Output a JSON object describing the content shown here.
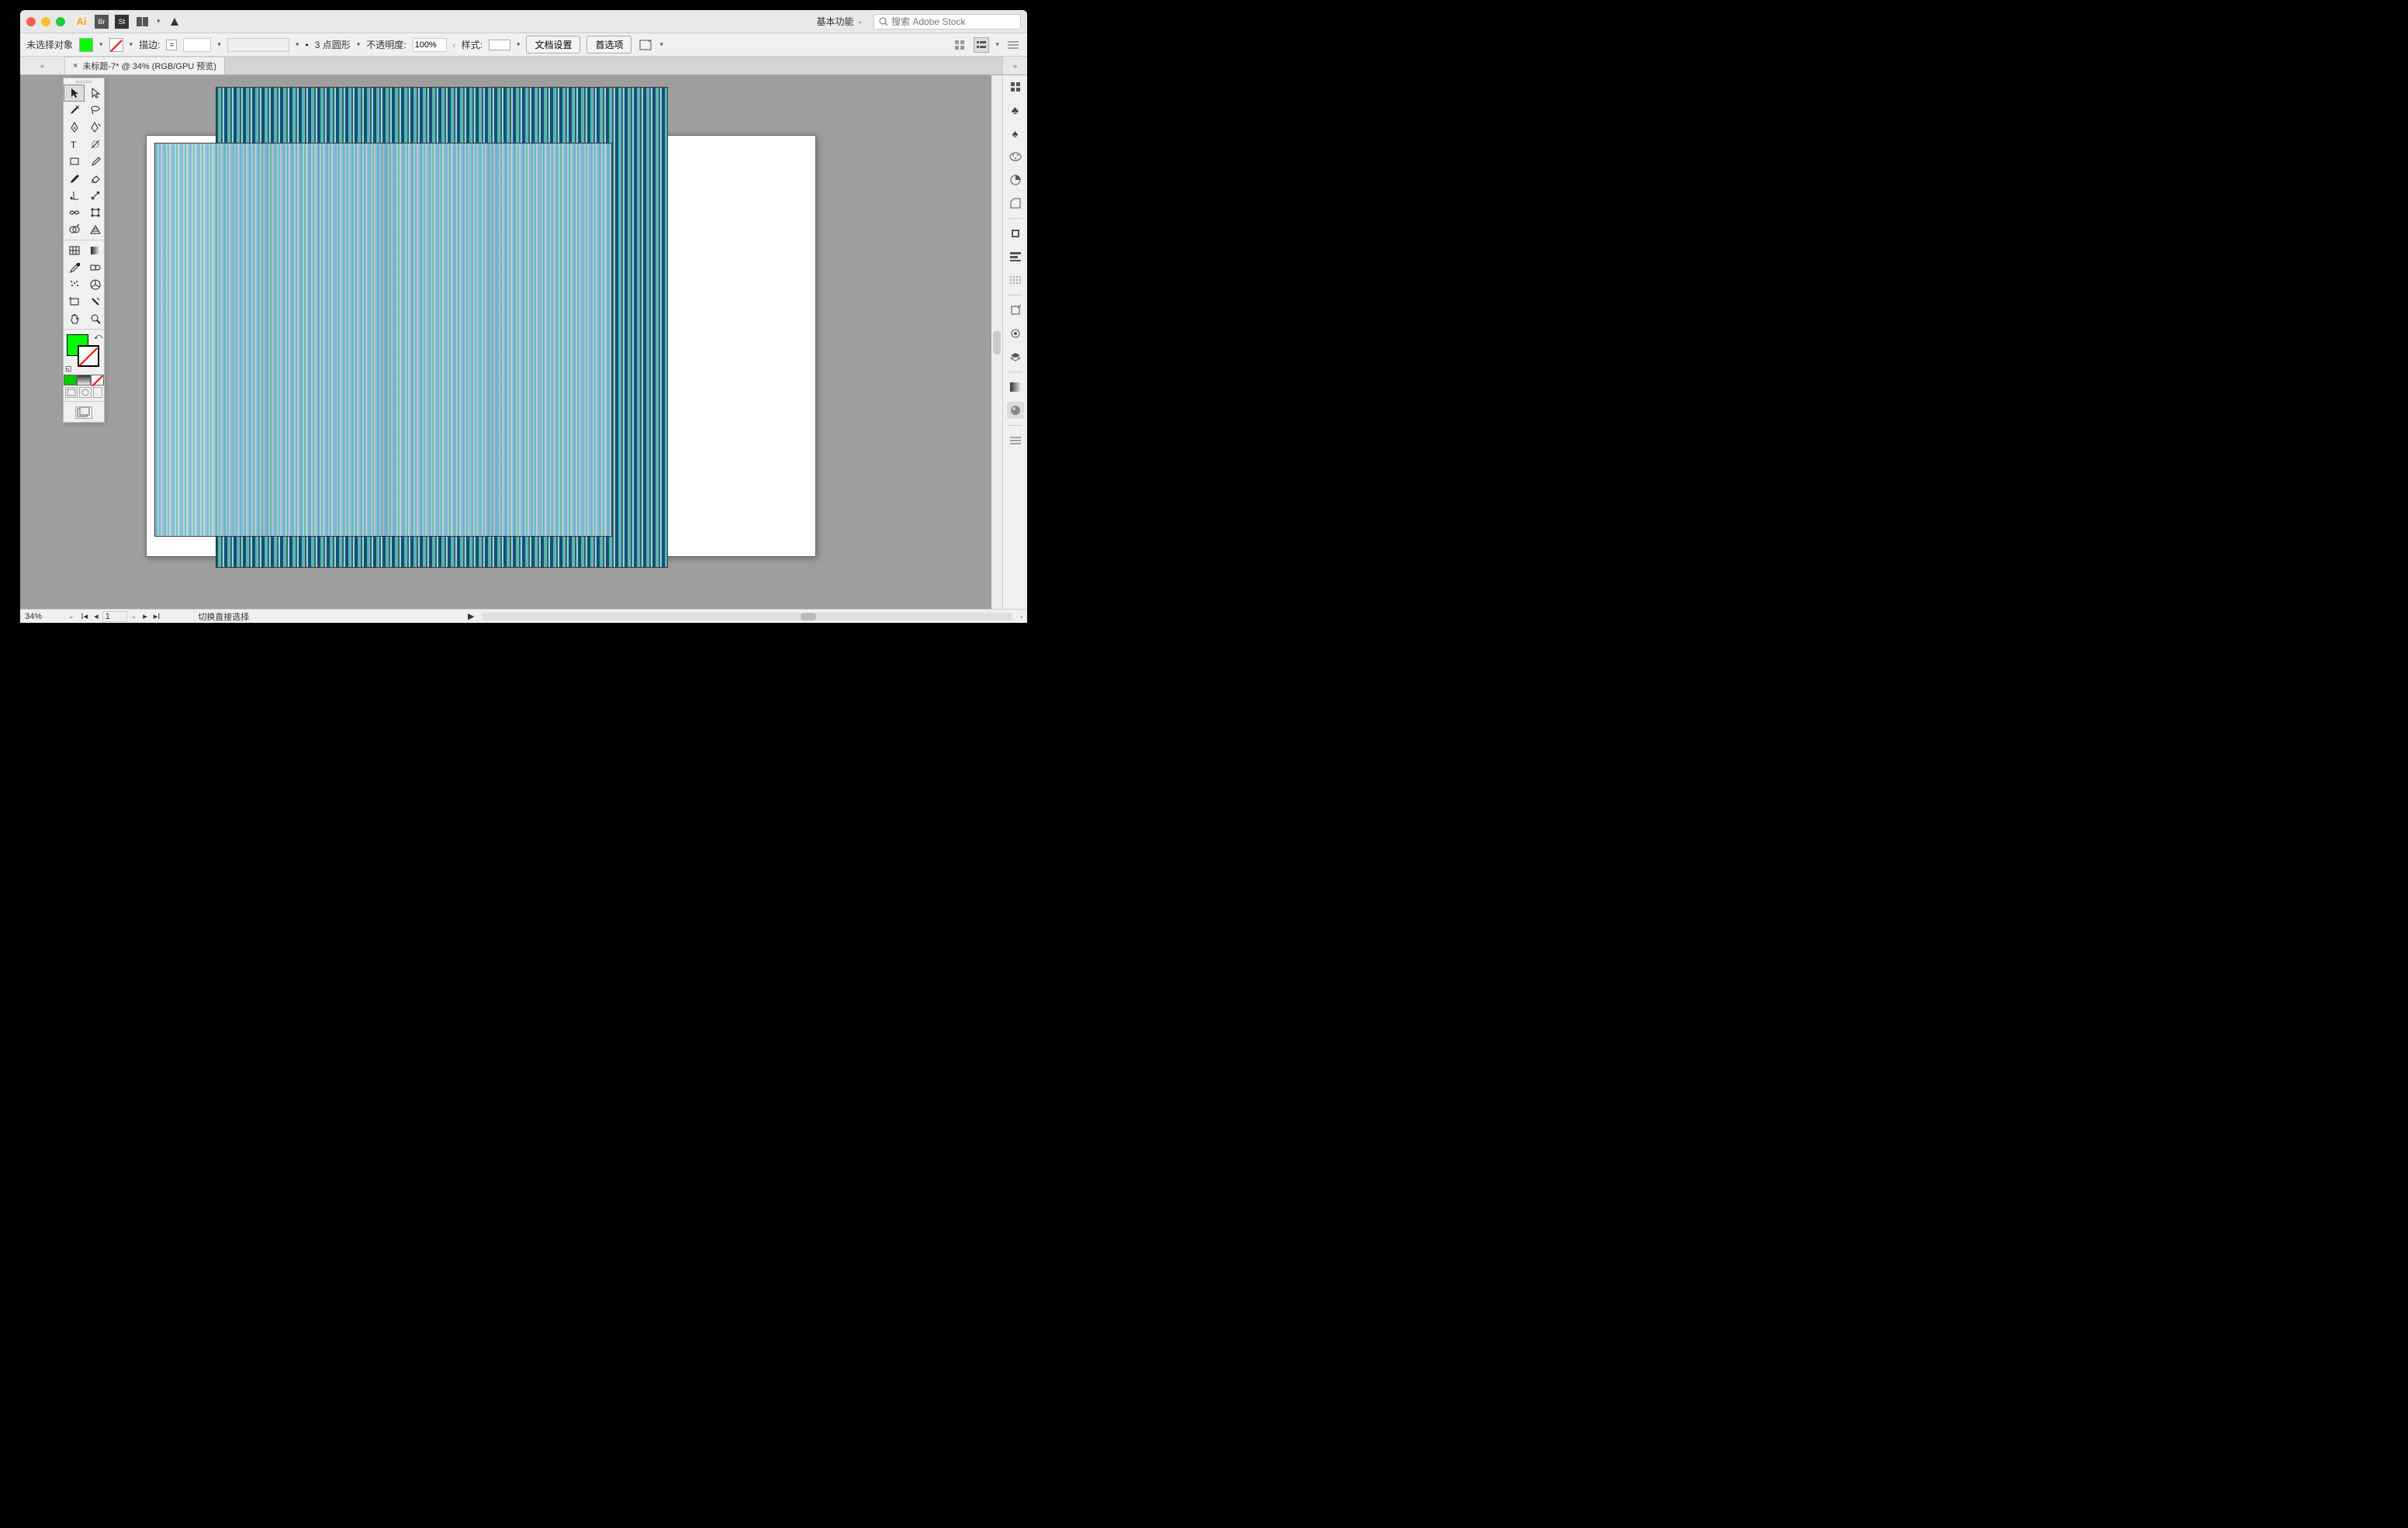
{
  "titlebar": {
    "app": "Ai",
    "br": "Br",
    "st": "St",
    "workspace": "基本功能",
    "search_placeholder": "搜索 Adobe Stock"
  },
  "controlbar": {
    "no_selection": "未选择对象",
    "stroke_label": "描边:",
    "stroke_value": "",
    "brush_preset": "",
    "point_style": "3 点圆形",
    "opacity_label": "不透明度:",
    "opacity_value": "100%",
    "style_label": "样式:",
    "doc_setup": "文档设置",
    "prefs": "首选项"
  },
  "tab": {
    "close": "×",
    "title": "未标题-7* @ 34% (RGB/GPU 预览)"
  },
  "statusbar": {
    "zoom": "34%",
    "artboard_num": "1",
    "hint": "切换直接选择"
  },
  "tools": {
    "rows": [
      [
        "selection",
        "direct-selection"
      ],
      [
        "magic-wand",
        "lasso"
      ],
      [
        "pen",
        "curvature"
      ],
      [
        "type",
        "line-segment"
      ],
      [
        "rectangle",
        "paintbrush"
      ],
      [
        "pencil",
        "eraser"
      ],
      [
        "rotate",
        "scale"
      ],
      [
        "width",
        "free-transform"
      ],
      [
        "shape-builder",
        "perspective"
      ],
      [
        "mesh",
        "gradient"
      ],
      [
        "eyedropper",
        "blend"
      ],
      [
        "symbol-sprayer",
        "column-graph"
      ],
      [
        "artboard",
        "slice"
      ],
      [
        "hand",
        "zoom"
      ]
    ]
  },
  "right_panels": [
    "properties",
    "libraries",
    "club",
    "color",
    "color-guide",
    "swatches",
    "sep",
    "stroke",
    "align",
    "pathfinder",
    "sep",
    "transform",
    "layers",
    "appearance",
    "sep",
    "graphic-styles",
    "sep",
    "expand"
  ],
  "colors": {
    "fill": "#00ff00",
    "stroke": "none"
  }
}
